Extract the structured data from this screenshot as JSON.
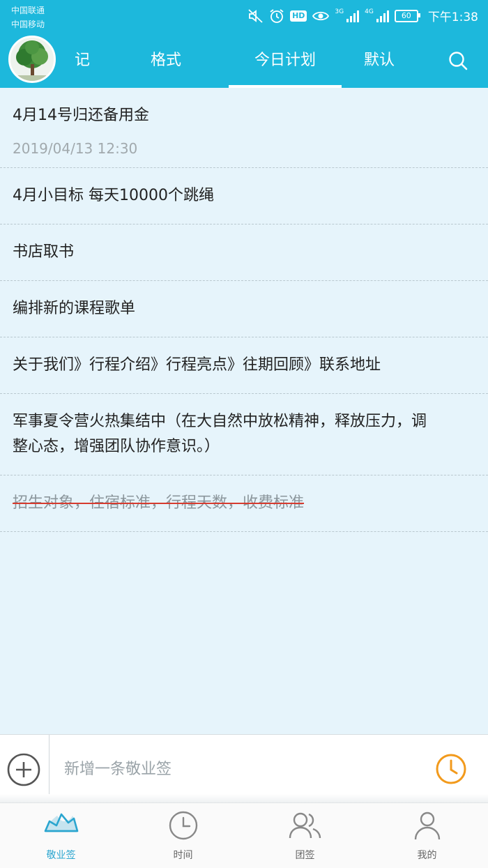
{
  "status_bar": {
    "carrier_1": "中国联通",
    "carrier_2": "中国移动",
    "hd": "HD",
    "net_1": "3G",
    "net_2": "4G",
    "battery": "60",
    "time": "下午1:38"
  },
  "top_tabs": [
    {
      "label": "记",
      "active": false
    },
    {
      "label": "格式",
      "active": false
    },
    {
      "label": "今日计划",
      "active": true
    },
    {
      "label": "默认",
      "active": false
    }
  ],
  "notes": [
    {
      "text": "4月14号归还备用金",
      "timestamp": "2019/04/13  12:30",
      "done": false
    },
    {
      "text": "4月小目标 每天10000个跳绳",
      "done": false
    },
    {
      "text": "书店取书",
      "done": false
    },
    {
      "text": "编排新的课程歌单",
      "done": false
    },
    {
      "text": "关于我们》行程介绍》行程亮点》往期回顾》联系地址",
      "done": false
    },
    {
      "text": "军事夏令营火热集结中（在大自然中放松精神，释放压力，调整心态，增强团队协作意识。）",
      "done": false
    },
    {
      "text": "招生对象，住宿标准，行程天数，收费标准",
      "done": true
    }
  ],
  "input_bar": {
    "placeholder": "新增一条敬业签"
  },
  "bottom_nav": [
    {
      "label": "敬业签",
      "icon": "note-icon",
      "active": true
    },
    {
      "label": "时间",
      "icon": "clock-icon",
      "active": false
    },
    {
      "label": "团签",
      "icon": "team-icon",
      "active": false
    },
    {
      "label": "我的",
      "icon": "person-icon",
      "active": false
    }
  ],
  "colors": {
    "accent": "#1db8dc",
    "background": "#e6f4fb",
    "reminder": "#f29a1c",
    "strike": "#d63a2e"
  }
}
